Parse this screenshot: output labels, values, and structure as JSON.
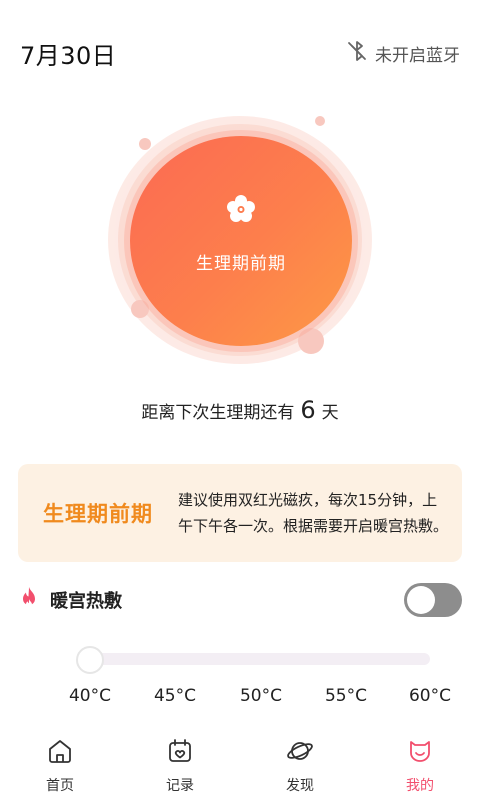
{
  "header": {
    "date": "7月30日",
    "bluetooth_status": "未开启蓝牙"
  },
  "cycle": {
    "phase_label": "生理期前期"
  },
  "countdown": {
    "prefix": "距离下次生理期还有",
    "days": "6",
    "suffix": "天"
  },
  "advice_card": {
    "title": "生理期前期",
    "text": "建议使用双红光磁疚，每次15分钟，上午下午各一次。根据需要开启暖宫热敷。"
  },
  "heat": {
    "label": "暖宫热敷",
    "enabled": false
  },
  "temperature": {
    "selected": "40°C",
    "levels": [
      "40°C",
      "45°C",
      "50°C",
      "55°C",
      "60°C"
    ]
  },
  "nav": {
    "items": [
      {
        "label": "首页",
        "icon": "home-icon"
      },
      {
        "label": "记录",
        "icon": "calendar-icon"
      },
      {
        "label": "发现",
        "icon": "planet-icon"
      },
      {
        "label": "我的",
        "icon": "profile-icon"
      }
    ],
    "active_index": 3
  },
  "colors": {
    "accent_orange": "#f08a1e",
    "active_pink": "#f24f6d",
    "core_gradient_start": "#fb6a53",
    "core_gradient_end": "#fd9a45"
  }
}
